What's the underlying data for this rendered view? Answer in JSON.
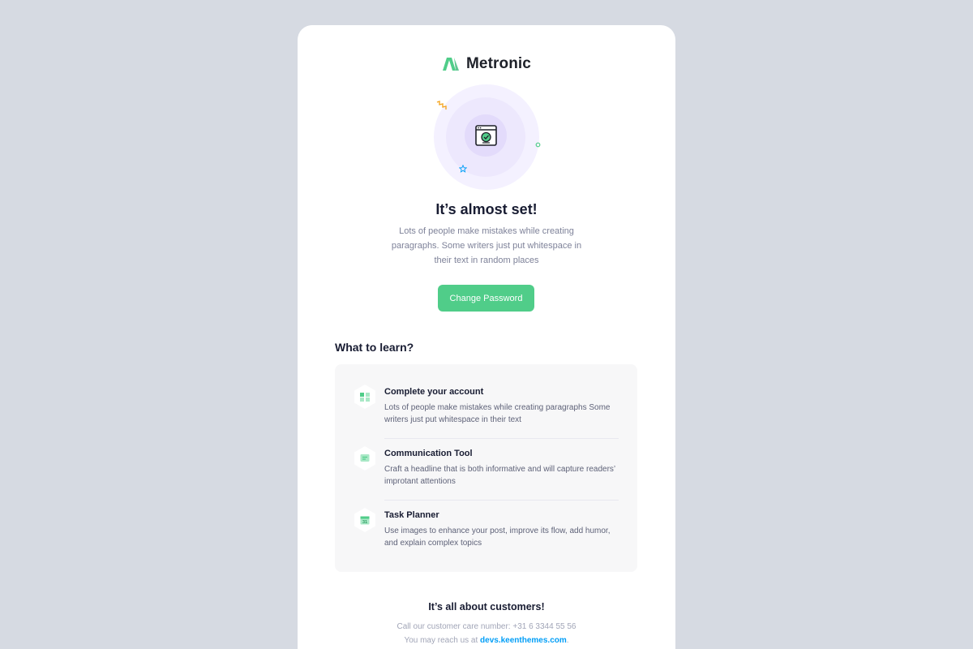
{
  "brand": {
    "name": "Metronic",
    "color": "#50cd89"
  },
  "hero": {
    "icon": "browser-check-icon"
  },
  "heading": {
    "title": "It’s almost set!",
    "subtitle": "Lots of people make mistakes while creating paragraphs. Some writers just put whitespace in their text in random places"
  },
  "cta": {
    "label": "Change Password",
    "color": "#50cd89"
  },
  "learn": {
    "title": "What to learn?",
    "items": [
      {
        "title": "Complete your account",
        "description": "Lots of people make mistakes while creating paragraphs Some writers just put whitespace in their text",
        "icon": "grid-icon"
      },
      {
        "title": "Communication Tool",
        "description": "Craft a headline that is both informative and will capture readers’ improtant attentions",
        "icon": "message-icon"
      },
      {
        "title": "Task Planner",
        "description": "Use images to enhance your post, improve its flow, add humor, and explain complex topics",
        "icon": "calendar-icon"
      }
    ]
  },
  "footer": {
    "title": "It’s all about customers!",
    "phone_line": "Call our customer care number: +31 6 3344 55 56",
    "reach_prefix": "You may reach us at ",
    "reach_link": "devs.keenthemes.com",
    "reach_suffix": "."
  },
  "colors": {
    "link": "#009ef7",
    "background": "#d6dae2"
  }
}
